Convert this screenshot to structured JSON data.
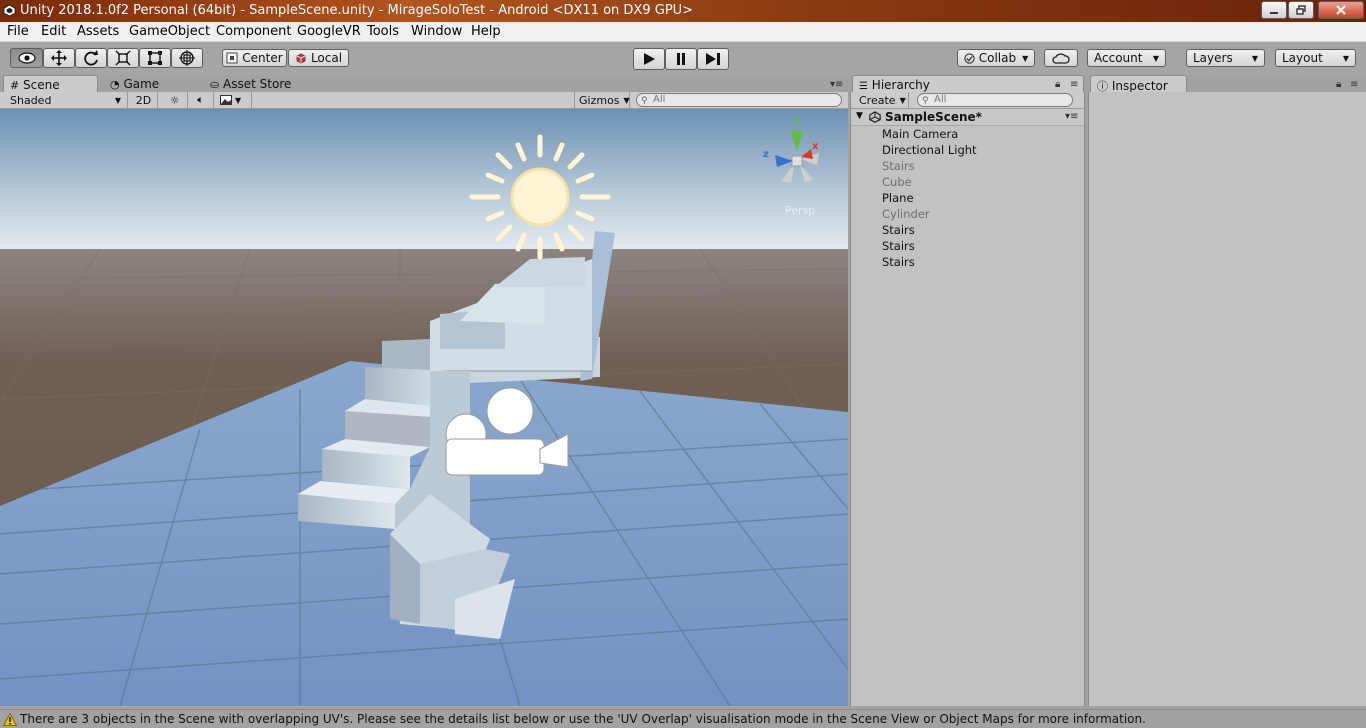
{
  "window": {
    "title": "Unity 2018.1.0f2 Personal (64bit) - SampleScene.unity - MirageSoloTest - Android <DX11 on DX9 GPU>"
  },
  "menu": {
    "items": [
      "File",
      "Edit",
      "Assets",
      "GameObject",
      "Component",
      "GoogleVR",
      "Tools",
      "Window",
      "Help"
    ]
  },
  "toolbar": {
    "tools": [
      "hand-tool",
      "move-tool",
      "rotate-tool",
      "scale-tool",
      "rect-tool",
      "transform-tool"
    ],
    "pivot_label": "Center",
    "space_label": "Local",
    "collab_label": "Collab",
    "account_label": "Account",
    "layers_label": "Layers",
    "layout_label": "Layout"
  },
  "scene_panel": {
    "tabs": [
      "Scene",
      "Game",
      "Asset Store"
    ],
    "shading_mode": "Shaded",
    "mode_2d": "2D",
    "gizmos_label": "Gizmos",
    "search_placeholder": "All",
    "projection_label": "Persp",
    "axis_labels": {
      "y": "y",
      "x": "x",
      "z": "z"
    }
  },
  "hierarchy": {
    "tab_label": "Hierarchy",
    "create_label": "Create",
    "search_placeholder": "All",
    "scene_name": "SampleScene*",
    "items": [
      {
        "label": "Main Camera",
        "active": true
      },
      {
        "label": "Directional Light",
        "active": true
      },
      {
        "label": "Stairs",
        "active": false
      },
      {
        "label": "Cube",
        "active": false
      },
      {
        "label": "Plane",
        "active": true
      },
      {
        "label": "Cylinder",
        "active": false
      },
      {
        "label": "Stairs",
        "active": true
      },
      {
        "label": "Stairs",
        "active": true
      },
      {
        "label": "Stairs",
        "active": true
      }
    ]
  },
  "inspector": {
    "tab_label": "Inspector"
  },
  "status": {
    "message": "There are 3 objects in the Scene with overlapping UV's. Please see the details list below or use the 'UV Overlap' visualisation mode in the Scene View or Object Maps for more information."
  },
  "colors": {
    "sky_top": "#6b8fb4",
    "sky_horizon": "#e6edf2",
    "ground": "#6e5e53",
    "plane": "#7c9bc9",
    "panel_bg": "#c2c2c2",
    "warning": "#f0c000"
  }
}
